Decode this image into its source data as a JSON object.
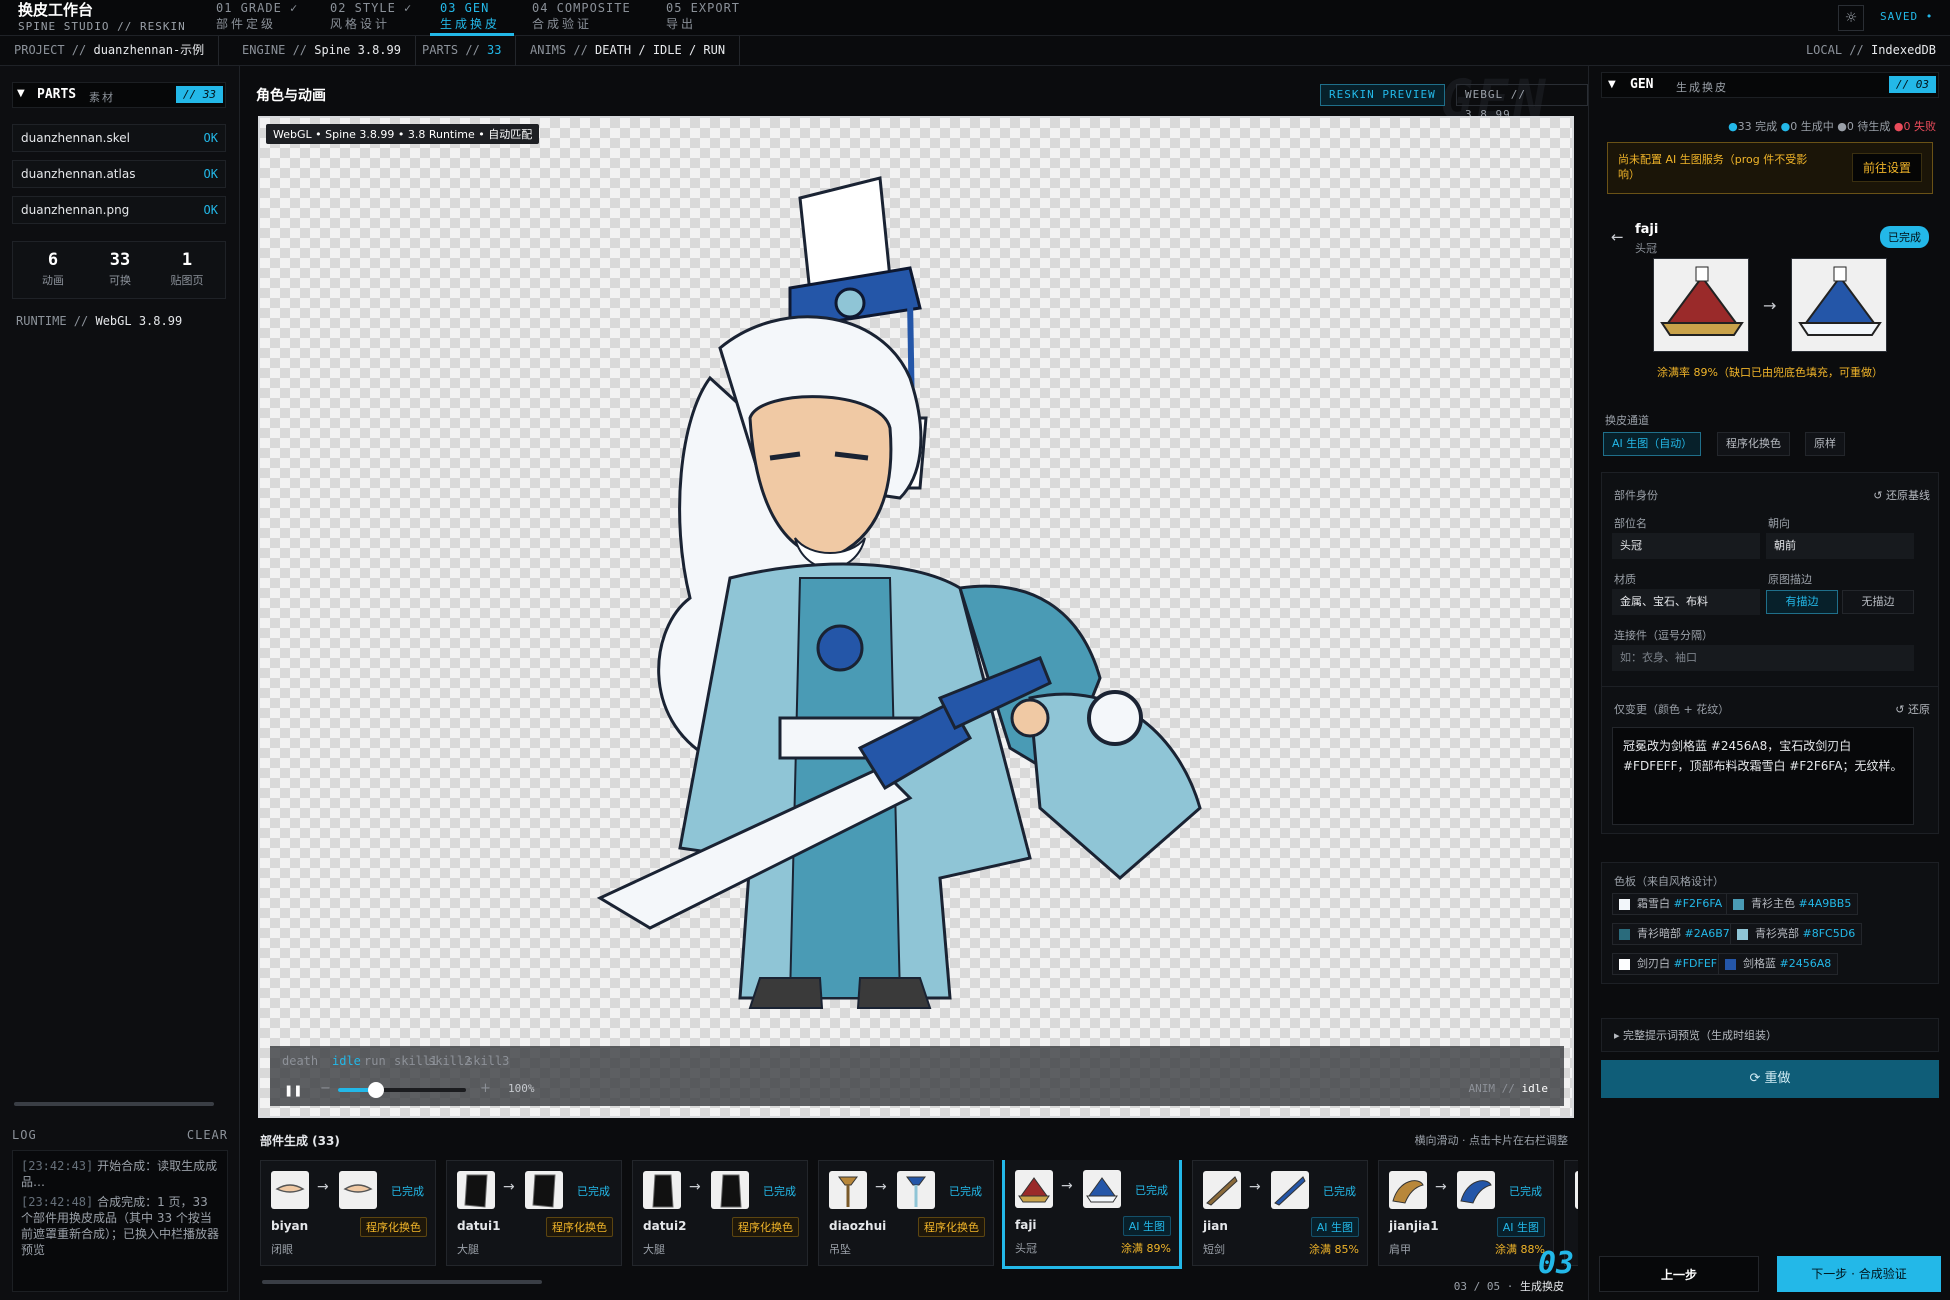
{
  "app": {
    "title": "换皮工作台",
    "subtitle": "SPINE STUDIO // RESKIN",
    "saved": "SAVED •"
  },
  "steps": [
    {
      "code": "01 GRADE ✓",
      "label": "部件定级"
    },
    {
      "code": "02 STYLE ✓",
      "label": "风格设计"
    },
    {
      "code": "03 GEN",
      "label": "生成换皮"
    },
    {
      "code": "04 COMPOSITE",
      "label": "合成验证"
    },
    {
      "code": "05 EXPORT",
      "label": "导出"
    }
  ],
  "subbar": {
    "project_k": "PROJECT //",
    "project_v": "duanzhennan-示例",
    "engine_k": "ENGINE //",
    "engine_v": "Spine 3.8.99",
    "parts_k": "PARTS //",
    "parts_v": "33",
    "anims_k": "ANIMS //",
    "anims_v": "DEATH / IDLE / RUN",
    "local_k": "LOCAL //",
    "local_v": "IndexedDB"
  },
  "left": {
    "title": "PARTS",
    "title_cn": "素材",
    "badge": "// 33",
    "files": [
      {
        "name": "duanzhennan.skel",
        "status": "OK"
      },
      {
        "name": "duanzhennan.atlas",
        "status": "OK"
      },
      {
        "name": "duanzhennan.png",
        "status": "OK"
      }
    ],
    "stats": [
      {
        "value": "6",
        "label": "动画"
      },
      {
        "value": "33",
        "label": "可换"
      },
      {
        "value": "1",
        "label": "贴图页"
      }
    ],
    "runtime_k": "RUNTIME //",
    "runtime_v": "WebGL 3.8.99",
    "log_title": "LOG",
    "log_clear": "CLEAR",
    "log": [
      {
        "ts": "[23:42:43]",
        "msg": "开始合成：读取生成成品…"
      },
      {
        "ts": "[23:42:48]",
        "msg": "合成完成：1 页，33 个部件用换皮成品（其中 33 个按当前遮罩重新合成）；已换入中栏播放器预览"
      }
    ]
  },
  "center": {
    "title": "角色与动画",
    "reskin_btn": "RESKIN PREVIEW",
    "webgl_tag": "WEBGL // 3.8.99",
    "watermark": "GEN",
    "stage_tag": "WebGL • Spine 3.8.99 • 3.8 Runtime • 自动匹配",
    "anims": [
      "death",
      "idle",
      "run",
      "skill1",
      "skill2",
      "skill3"
    ],
    "active_anim": "idle",
    "speed": 0.3,
    "zoom": "100%",
    "anim_k": "ANIM //",
    "anim_v": "idle",
    "pause_icon": "❚❚",
    "minus": "−",
    "plus": "+",
    "strip_title": "部件生成 (33)",
    "strip_hint": "横向滑动 · 点击卡片在右栏调整",
    "done_label": "已完成",
    "page_prefix": "03 / 05 ·",
    "page_label": "生成换皮",
    "big_num": "03",
    "parts": [
      {
        "name": "biyan",
        "cn": "闭眼",
        "tag": "程序化换色",
        "type": "proc",
        "rate": ""
      },
      {
        "name": "datui1",
        "cn": "大腿",
        "tag": "程序化换色",
        "type": "proc",
        "rate": ""
      },
      {
        "name": "datui2",
        "cn": "大腿",
        "tag": "程序化换色",
        "type": "proc",
        "rate": ""
      },
      {
        "name": "diaozhui",
        "cn": "吊坠",
        "tag": "程序化换色",
        "type": "proc",
        "rate": ""
      },
      {
        "name": "faji",
        "cn": "头冠",
        "tag": "AI 生图",
        "type": "ai",
        "rate": "涂满 89%"
      },
      {
        "name": "jian",
        "cn": "短剑",
        "tag": "AI 生图",
        "type": "ai",
        "rate": "涂满 85%"
      },
      {
        "name": "jianjia1",
        "cn": "肩甲",
        "tag": "AI 生图",
        "type": "ai",
        "rate": "涂满 88%"
      }
    ]
  },
  "right": {
    "title": "GEN",
    "title_cn": "生成换皮",
    "badge": "// 03",
    "status": {
      "done": "33 完成",
      "gen": "0 生成中",
      "wait": "0 待生成",
      "fail": "0 失败"
    },
    "warn": "尚未配置 AI 生图服务（prog 件不受影响）",
    "warn_btn": "前往设置",
    "part": {
      "name": "faji",
      "cn": "头冠",
      "status": "已完成",
      "rate_note": "涂满率 89%（缺口已由兜底色填充，可重做）"
    },
    "channel_label": "换皮通道",
    "channels": [
      "AI 生图（自动）",
      "程序化换色",
      "原样"
    ],
    "identity": {
      "title": "部件身份",
      "reset": "↺ 还原基线",
      "pos_label": "部位名",
      "pos_value": "头冠",
      "dir_label": "朝向",
      "dir_value": "朝前",
      "mat_label": "材质",
      "mat_value": "金属、宝石、布料",
      "stroke_label": "原图描边",
      "stroke_on": "有描边",
      "stroke_off": "无描边",
      "conn_label": "连接件（逗号分隔）",
      "conn_placeholder": "如：衣身、袖口"
    },
    "change": {
      "title": "仅变更（颜色 + 花纹）",
      "reset": "↺ 还原",
      "text": "冠冕改为剑格蓝 #2456A8，宝石改剑刃白 #FDFEFF，顶部布料改霜雪白 #F2F6FA；无纹样。"
    },
    "palette_title": "色板（来自风格设计）",
    "palette": [
      {
        "name": "霜雪白",
        "hex": "#F2F6FA"
      },
      {
        "name": "青衫主色",
        "hex": "#4A9BB5"
      },
      {
        "name": "青衫暗部",
        "hex": "#2A6B7C"
      },
      {
        "name": "青衫亮部",
        "hex": "#8FC5D6"
      },
      {
        "name": "剑刃白",
        "hex": "#FDFEFF"
      },
      {
        "name": "剑格蓝",
        "hex": "#2456A8"
      }
    ],
    "expander": "▸ 完整提示词预览（生成时组装）",
    "redo": "重做",
    "prev": "上一步",
    "next": "下一步 · 合成验证"
  }
}
